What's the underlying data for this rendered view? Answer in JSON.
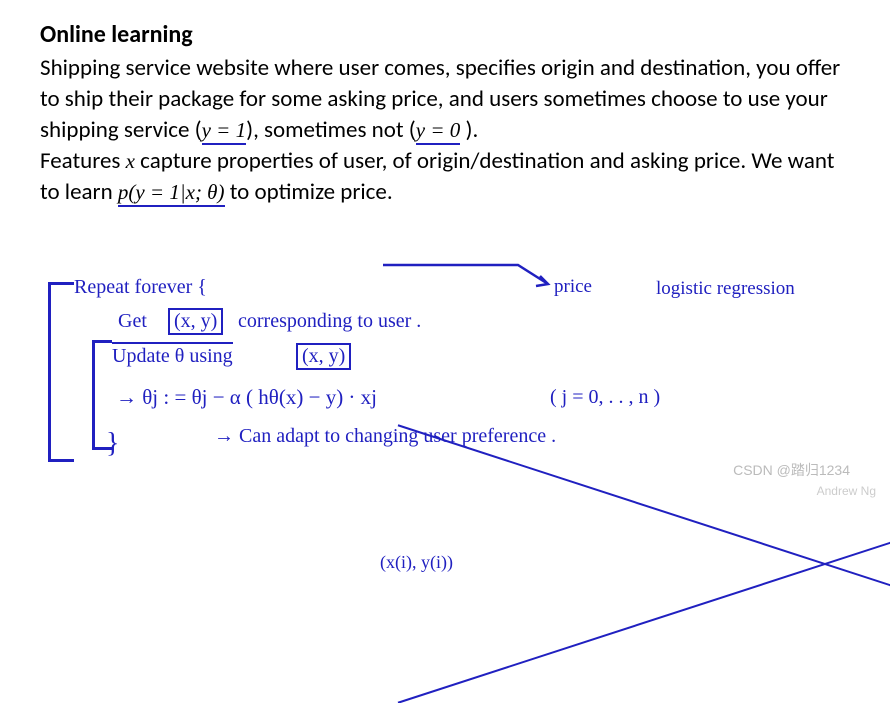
{
  "heading": "Online learning",
  "paragraph1_part1": "Shipping service website where user comes, specifies origin and destination, you offer to ship their package for some asking price, and users sometimes choose to use your shipping service (",
  "math_y1": "y = 1",
  "paragraph1_part2": "), sometimes not (",
  "math_y0": "y = 0",
  "paragraph1_part3": " ).",
  "paragraph2_part1": "Features ",
  "math_x": "x",
  "paragraph2_part2": "  capture properties of user, of origin/destination and asking price. We want to learn ",
  "math_p": "p(y = 1|x; θ)",
  "paragraph2_part3": "  to optimize price.",
  "hw": {
    "repeat": "Repeat   forever  {",
    "get": "Get",
    "xy1": "(x, y)",
    "corresponding": "corresponding  to   user .",
    "update": "Update   θ   using",
    "xy2": "(x, y)",
    "strike_xy": "(x(i), y(i))",
    "arrow_formula": "→  θj : =  θj  − α ( hθ(x) − y) · xj",
    "j_range": "( j = 0, . . , n )",
    "can_adapt": "→ Can   adapt  to   changing    user   preference .",
    "price_label": "price",
    "logistic": "logistic  regression",
    "close_brace": "}"
  },
  "watermark_csdn": "CSDN @踏归1234",
  "watermark_andrew": "Andrew Ng"
}
